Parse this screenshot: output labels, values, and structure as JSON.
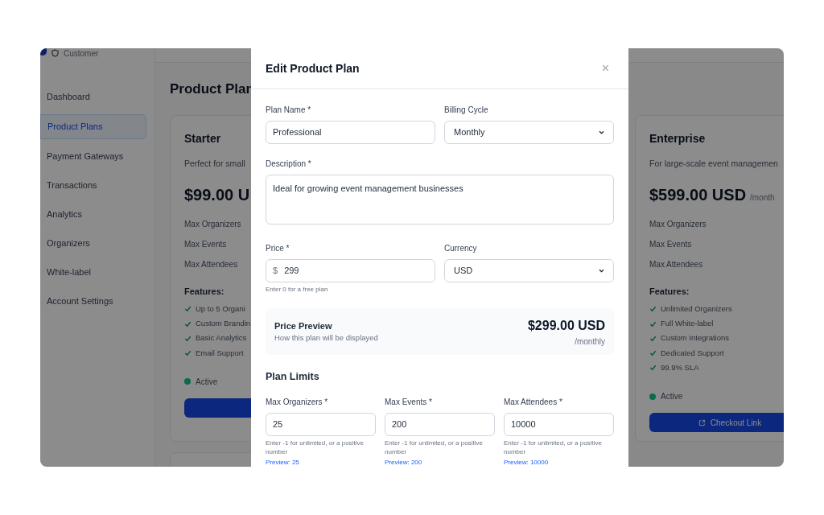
{
  "sidebar": {
    "brand": "Customer",
    "items": [
      {
        "label": "Dashboard",
        "selected": false
      },
      {
        "label": "Product Plans",
        "selected": true
      },
      {
        "label": "Payment Gateways",
        "selected": false
      },
      {
        "label": "Transactions",
        "selected": false
      },
      {
        "label": "Analytics",
        "selected": false
      },
      {
        "label": "Organizers",
        "selected": false
      },
      {
        "label": "White-label",
        "selected": false
      },
      {
        "label": "Account Settings",
        "selected": false
      }
    ]
  },
  "page": {
    "title": "Product Plan"
  },
  "plans": [
    {
      "name": "Starter",
      "description": "Perfect for small",
      "price": "$99.00 U",
      "limits": [
        "Max Organizers",
        "Max Events",
        "Max Attendees"
      ],
      "features_heading": "Features:",
      "features": [
        "Up to 5 Organi",
        "Custom Brandin",
        "Basic Analytics",
        "Email Support"
      ],
      "status": {
        "label": "Active",
        "color": "#0b6b47"
      }
    },
    {
      "name": "Enterprise",
      "description": "For large-scale event managemen",
      "price": "$599.00 USD",
      "period": "/month",
      "limits": [
        "Max Organizers",
        "Max Events",
        "Max Attendees"
      ],
      "features_heading": "Features:",
      "features": [
        "Unlimited Organizers",
        "Full White-label",
        "Custom Integrations",
        "Dedicated Support",
        "99.9% SLA"
      ],
      "status": {
        "label": "Active",
        "color": "#0b6b47"
      },
      "button": "Checkout Link"
    }
  ],
  "modal": {
    "title": "Edit Product Plan",
    "close": "×",
    "plan_name": {
      "label": "Plan Name *",
      "value": "Professional"
    },
    "billing_cycle": {
      "label": "Billing Cycle",
      "value": "Monthly"
    },
    "description": {
      "label": "Description *",
      "value": "Ideal for growing event management businesses"
    },
    "price": {
      "label": "Price *",
      "prefix": "$",
      "value": "299",
      "hint": "Enter 0 for a free plan"
    },
    "currency": {
      "label": "Currency",
      "value": "USD"
    },
    "preview": {
      "title": "Price Preview",
      "subtitle": "How this plan will be displayed",
      "amount": "$299.00 USD",
      "period": "/monthly"
    },
    "limits": {
      "heading": "Plan Limits",
      "fields": [
        {
          "label": "Max Organizers *",
          "value": "25",
          "hint": "Enter -1 for unlimited, or a positive number",
          "preview": "Preview: 25"
        },
        {
          "label": "Max Events *",
          "value": "200",
          "hint": "Enter -1 for unlimited, or a positive number",
          "preview": "Preview: 200"
        },
        {
          "label": "Max Attendees *",
          "value": "10000",
          "hint": "Enter -1 for unlimited, or a positive number",
          "preview": "Preview: 10000"
        }
      ]
    }
  }
}
